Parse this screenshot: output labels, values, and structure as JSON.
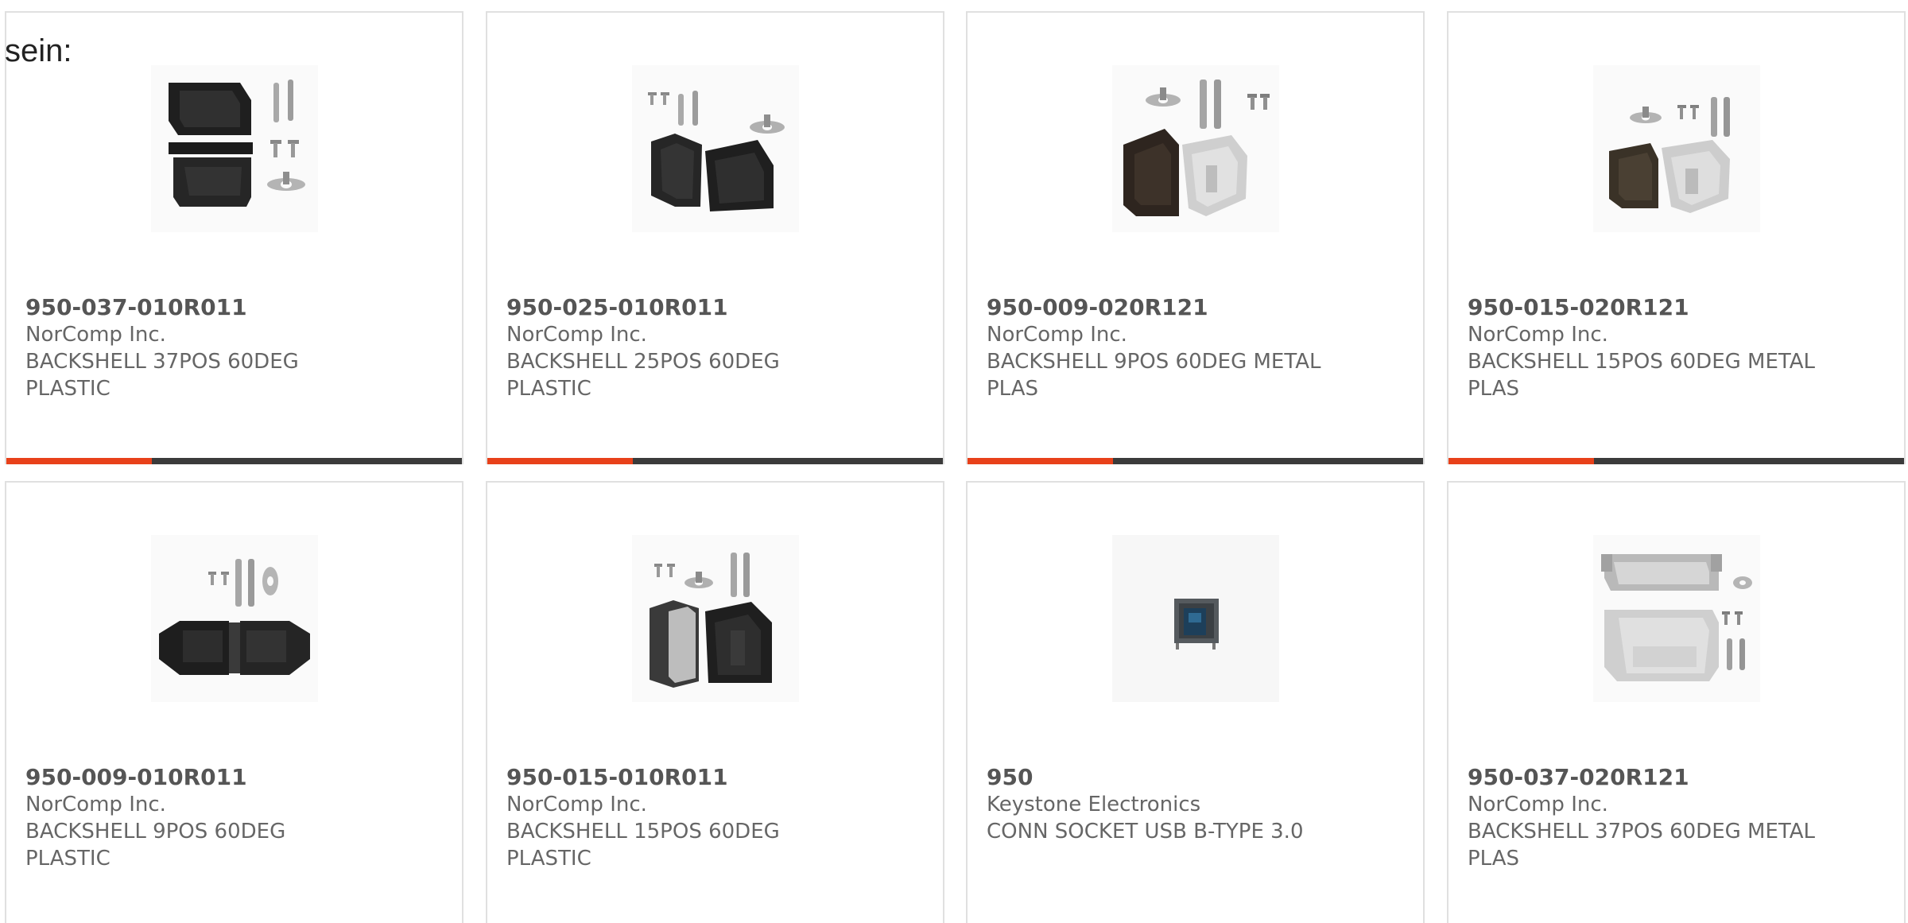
{
  "intro_text": "sein:",
  "colors": {
    "accent": "#e8411a",
    "bar_track": "#3b3b3b",
    "card_border": "#e0e0e0",
    "text": "#555555"
  },
  "products": [
    {
      "part_number": "950-037-010R011",
      "manufacturer": "NorComp Inc.",
      "description": "BACKSHELL 37POS 60DEG PLASTIC",
      "image_icon": "black-plastic-backshell-kit-icon",
      "rating_fraction": 0.32
    },
    {
      "part_number": "950-025-010R011",
      "manufacturer": "NorComp Inc.",
      "description": "BACKSHELL 25POS 60DEG PLASTIC",
      "image_icon": "black-plastic-backshell-kit-icon",
      "rating_fraction": 0.32
    },
    {
      "part_number": "950-009-020R121",
      "manufacturer": "NorComp Inc.",
      "description": "BACKSHELL 9POS 60DEG METAL PLAS",
      "image_icon": "metal-plastic-backshell-kit-icon",
      "rating_fraction": 0.32
    },
    {
      "part_number": "950-015-020R121",
      "manufacturer": "NorComp Inc.",
      "description": "BACKSHELL 15POS 60DEG METAL PLAS",
      "image_icon": "metal-plastic-backshell-kit-icon",
      "rating_fraction": 0.32
    },
    {
      "part_number": "950-009-010R011",
      "manufacturer": "NorComp Inc.",
      "description": "BACKSHELL 9POS 60DEG PLASTIC",
      "image_icon": "black-plastic-backshell-kit-icon"
    },
    {
      "part_number": "950-015-010R011",
      "manufacturer": "NorComp Inc.",
      "description": "BACKSHELL 15POS 60DEG PLASTIC",
      "image_icon": "black-plastic-backshell-kit-icon"
    },
    {
      "part_number": "950",
      "manufacturer": "Keystone Electronics",
      "description": "CONN SOCKET USB B-TYPE 3.0",
      "image_icon": "usb-socket-icon"
    },
    {
      "part_number": "950-037-020R121",
      "manufacturer": "NorComp Inc.",
      "description": "BACKSHELL 37POS 60DEG METAL PLAS",
      "image_icon": "metal-backshell-kit-icon"
    }
  ]
}
